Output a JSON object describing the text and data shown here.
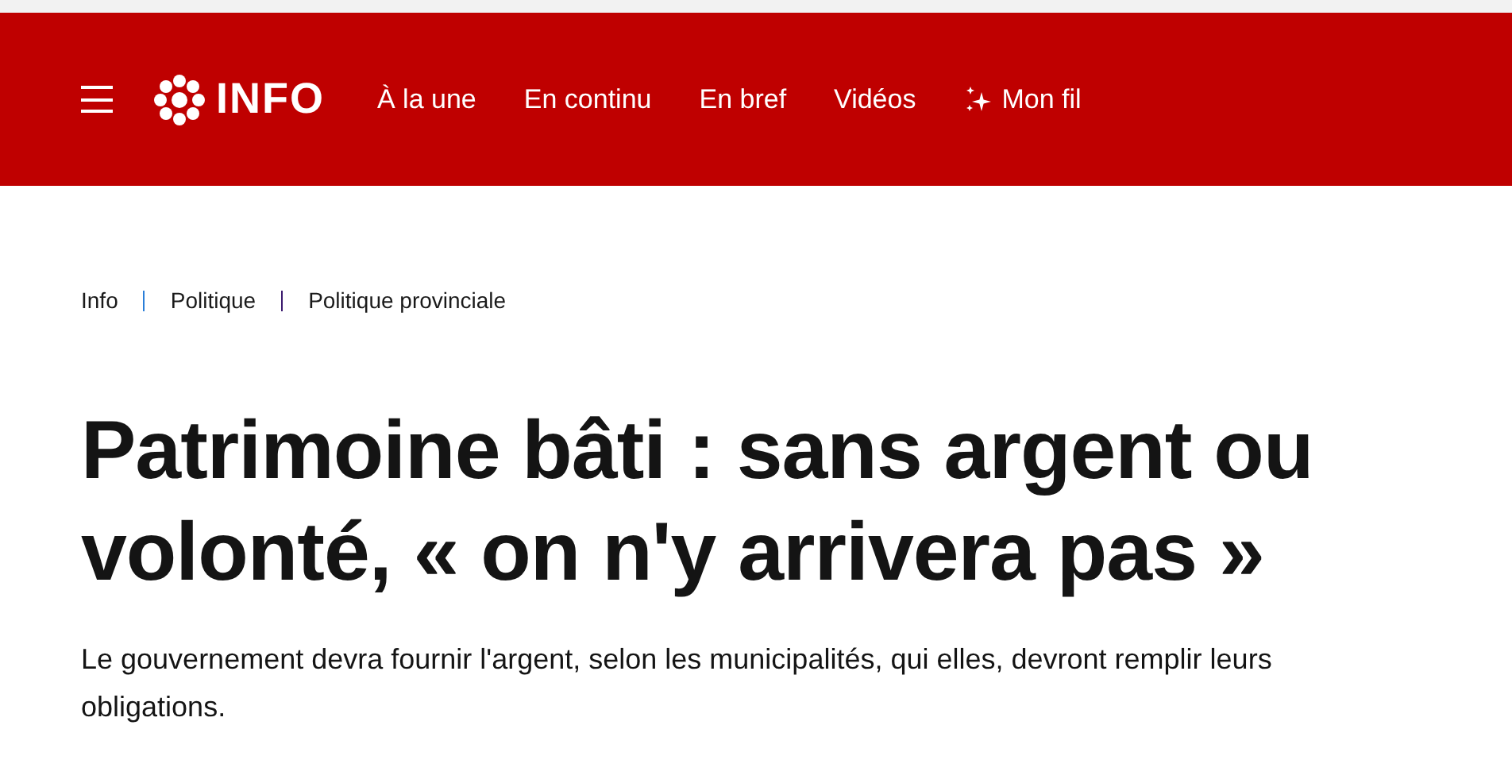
{
  "header": {
    "logo_text": "INFO",
    "nav": [
      {
        "label": "À la une",
        "kind": "plain"
      },
      {
        "label": "En continu",
        "kind": "plain"
      },
      {
        "label": "En bref",
        "kind": "plain"
      },
      {
        "label": "Vidéos",
        "kind": "plain"
      },
      {
        "label": "Mon fil",
        "kind": "sparkle"
      }
    ]
  },
  "breadcrumb": [
    "Info",
    "Politique",
    "Politique provinciale"
  ],
  "article": {
    "title": "Patrimoine bâti : sans argent ou volonté, « on n'y arrivera pas »",
    "summary": "Le gouvernement devra fournir l'argent, selon les municipalités, qui elles, devront remplir leurs obligations."
  }
}
